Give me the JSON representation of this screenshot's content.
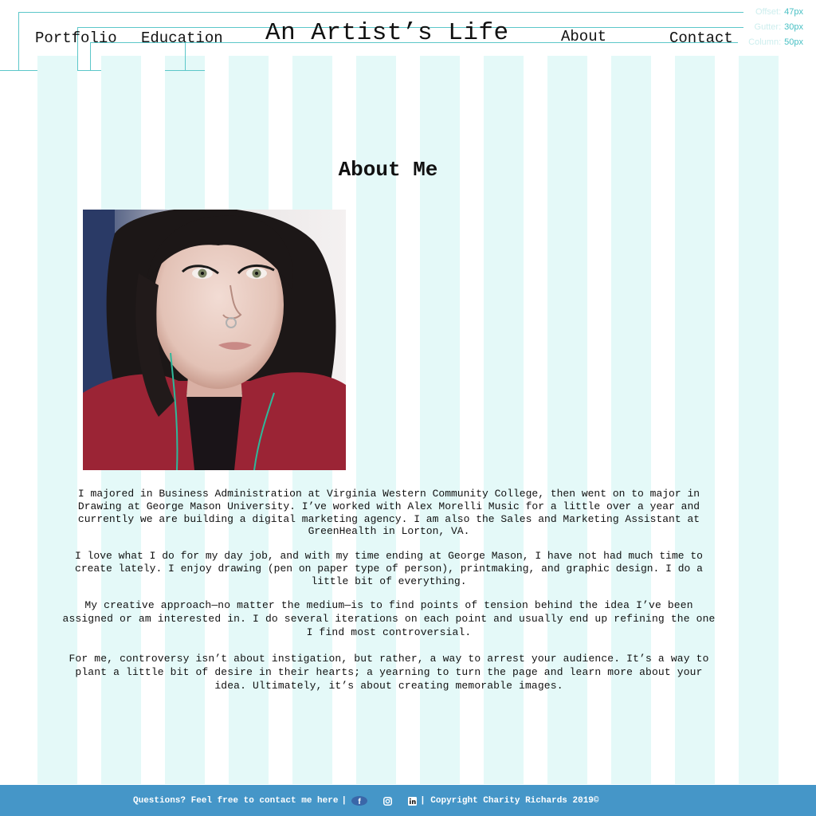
{
  "nav": {
    "portfolio": "Portfolio",
    "education": "Education",
    "about": "About",
    "contact": "Contact"
  },
  "site_title": "An Artist’s Life",
  "grid_legend": {
    "offset_label": "Offset:",
    "offset_value": "47px",
    "gutter_label": "Gutter:",
    "gutter_value": "30px",
    "column_label": "Column:",
    "column_value": "50px"
  },
  "page_title": "About Me",
  "bio": [
    "I majored in Business Administration at Virginia Western Community College, then went on to major in Drawing at George Mason University. I’ve worked with Alex Morelli Music for a little over a year and currently we are building a digital marketing agency. I am also the Sales and Marketing Assistant at GreenHealth in Lorton, VA.",
    "I love what I do for my day job, and with my time ending at George Mason, I have not had much time to create lately. I enjoy drawing (pen on paper type of person), printmaking, and graphic design. I do a little bit of everything.",
    "My creative approach—no matter the medium—is to find points of tension behind the idea I’ve been assigned or am interested in. I do several iterations on each point and usually end up refining the one I find most controversial.",
    "For me, controversy isn’t about instigation, but rather, a way to arrest your audience. It’s a way to plant a little bit of desire in their hearts; a yearning to turn the page and learn more about your idea. Ultimately, it’s about creating memorable images."
  ],
  "footer": {
    "contact_text": "Questions? Feel free to contact me here",
    "sep": "|",
    "copyright": "| Copyright Charity Richards 2019©",
    "icons": [
      "facebook-icon",
      "instagram-icon",
      "linkedin-icon"
    ]
  },
  "colors": {
    "grid_column": "#e4f9f8",
    "guide_line": "#5cc7c9",
    "footer_bg": "#4596c8"
  }
}
